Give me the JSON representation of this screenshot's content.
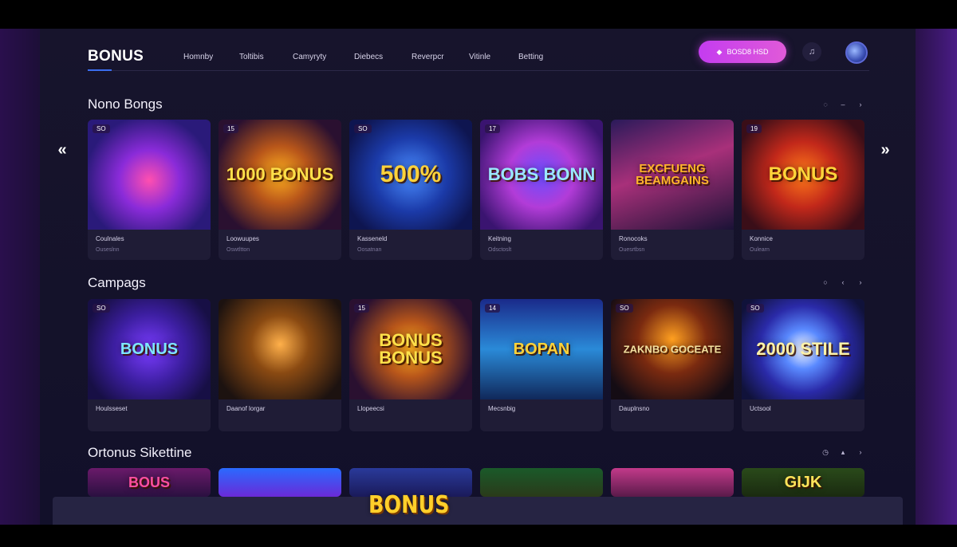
{
  "header": {
    "logo": "BONUS",
    "nav": [
      "Homnby",
      "Toltibis",
      "Camyryty",
      "Diebecs",
      "Reverpcr",
      "Vitinle",
      "Betting"
    ],
    "cta_label": "BOSD8 HSD",
    "user_icon": "user-icon"
  },
  "sections": [
    {
      "title": "Nono Bongs",
      "cards": [
        {
          "badge": "SO",
          "art_text": "",
          "art_style": "pot",
          "name": "Coulnales",
          "sub": "Ouseslnn"
        },
        {
          "badge": "15",
          "art_text": "1000 BONUS",
          "art_style": "gold",
          "name": "Loowuupes",
          "sub": "Oswtltton"
        },
        {
          "badge": "SO",
          "art_text": "500%",
          "art_style": "gold-blue",
          "name": "Kasseneld",
          "sub": "Oosatnan"
        },
        {
          "badge": "17",
          "art_text": "BOBS BONN",
          "art_style": "neon",
          "name": "Keitning",
          "sub": "Odsctoslt"
        },
        {
          "badge": "",
          "art_text": "EXCFUENG BEAMGAINS",
          "art_style": "orange",
          "name": "Ronocoks",
          "sub": "Ouesrtbsn"
        },
        {
          "badge": "19",
          "art_text": "BONUS",
          "art_style": "fire",
          "name": "Konnice",
          "sub": "Oulearn"
        }
      ]
    },
    {
      "title": "Campags",
      "cards": [
        {
          "badge": "SO",
          "art_text": "BONUS",
          "art_style": "neon-blue",
          "name": "Houlsseset",
          "sub": ""
        },
        {
          "badge": "",
          "art_text": "",
          "art_style": "warrior",
          "name": "Daanof lorgar",
          "sub": ""
        },
        {
          "badge": "15",
          "art_text": "BONUS BONUS",
          "art_style": "gold",
          "name": "Llopeecsi",
          "sub": ""
        },
        {
          "badge": "14",
          "art_text": "BOPAN",
          "art_style": "teal",
          "name": "Mecsnbig",
          "sub": ""
        },
        {
          "badge": "SO",
          "art_text": "ZAKNBO GOCEATE",
          "art_style": "bear",
          "name": "Dauplnsno",
          "sub": ""
        },
        {
          "badge": "SO",
          "art_text": "2000 STILE",
          "art_style": "blast",
          "name": "Uctsool",
          "sub": ""
        }
      ]
    },
    {
      "title": "Ortonus Sikettine",
      "cards": [
        {
          "badge": "",
          "art_text": "BOUS",
          "art_style": "pink",
          "name": "",
          "sub": ""
        },
        {
          "badge": "",
          "art_text": "",
          "art_style": "sport",
          "name": "",
          "sub": ""
        },
        {
          "badge": "",
          "art_text": "",
          "art_style": "coin",
          "name": "",
          "sub": ""
        },
        {
          "badge": "",
          "art_text": "",
          "art_style": "green",
          "name": "",
          "sub": ""
        },
        {
          "badge": "",
          "art_text": "",
          "art_style": "coin-pink",
          "name": "",
          "sub": ""
        },
        {
          "badge": "",
          "art_text": "GIJK",
          "art_style": "ball",
          "name": "",
          "sub": ""
        }
      ]
    }
  ],
  "footer": {
    "logo": "BONUS"
  }
}
